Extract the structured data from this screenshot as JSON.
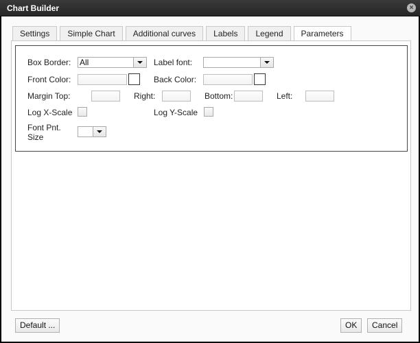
{
  "window": {
    "title": "Chart Builder",
    "close_icon": "close-circle-icon"
  },
  "tabs": [
    {
      "label": "Settings",
      "active": false
    },
    {
      "label": "Simple Chart",
      "active": false
    },
    {
      "label": "Additional curves",
      "active": false
    },
    {
      "label": "Labels",
      "active": false
    },
    {
      "label": "Legend",
      "active": false
    },
    {
      "label": "Parameters",
      "active": true
    }
  ],
  "parameters": {
    "box_border": {
      "label": "Box Border:",
      "value": "All"
    },
    "label_font": {
      "label": "Label font:",
      "value": ""
    },
    "front_color": {
      "label": "Front Color:",
      "value": ""
    },
    "back_color": {
      "label": "Back Color:",
      "value": ""
    },
    "margin_top": {
      "label": "Margin Top:",
      "value": ""
    },
    "margin_right": {
      "label": "Right:",
      "value": ""
    },
    "margin_bottom": {
      "label": "Bottom:",
      "value": ""
    },
    "margin_left": {
      "label": "Left:",
      "value": ""
    },
    "log_x_scale": {
      "label": "Log X-Scale",
      "checked": false
    },
    "log_y_scale": {
      "label": "Log Y-Scale",
      "checked": false
    },
    "font_pnt_size": {
      "label_line1": "Font Pnt.",
      "label_line2": "Size",
      "value": ""
    }
  },
  "footer": {
    "default_label": "Default ...",
    "ok_label": "OK",
    "cancel_label": "Cancel"
  }
}
